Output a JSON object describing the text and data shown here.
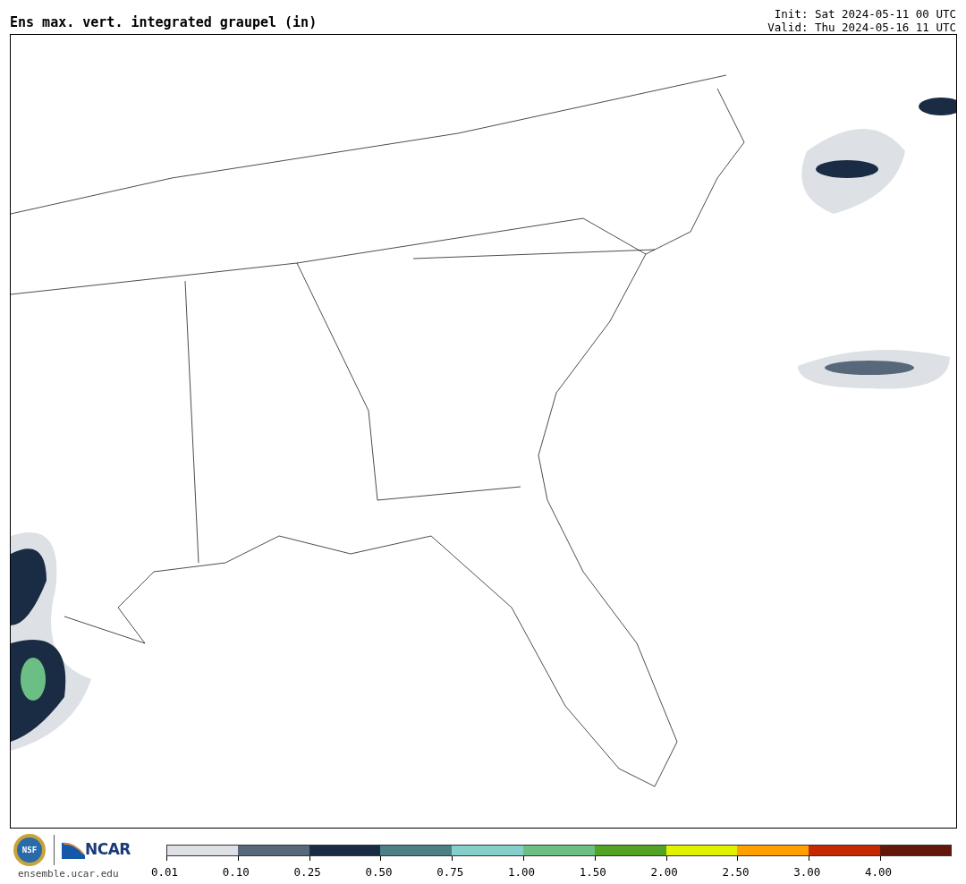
{
  "title": "Ens max. vert. integrated graupel (in)",
  "init": "Init: Sat 2024-05-11 00 UTC",
  "valid": "Valid: Thu 2024-05-16 11 UTC",
  "logos": {
    "nsf": "NSF",
    "ncar": "NCAR",
    "site": "ensemble.ucar.edu"
  },
  "colorbar": [
    {
      "color": "#dde1e5",
      "label": "0.01"
    },
    {
      "color": "#58687b",
      "label": "0.10"
    },
    {
      "color": "#1a2c44",
      "label": "0.25"
    },
    {
      "color": "#4d8085",
      "label": "0.50"
    },
    {
      "color": "#84cfc9",
      "label": "0.75"
    },
    {
      "color": "#6cbf84",
      "label": "1.00"
    },
    {
      "color": "#52a323",
      "label": "1.50"
    },
    {
      "color": "#e0f200",
      "label": "2.00"
    },
    {
      "color": "#ffa000",
      "label": "2.50"
    },
    {
      "color": "#c62800",
      "label": "3.00"
    },
    {
      "color": "#63170b",
      "label": "4.00"
    }
  ]
}
